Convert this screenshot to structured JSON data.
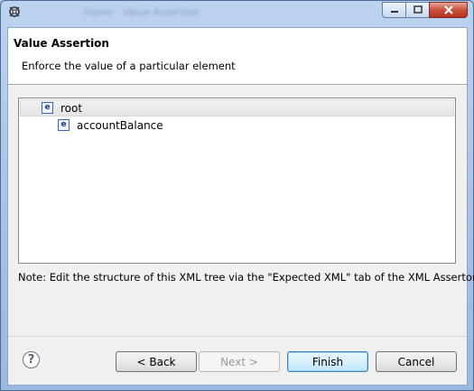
{
  "window": {
    "title": "Home · Value Assertion",
    "caption_buttons": [
      "minimize-icon",
      "maximize-icon",
      "close-icon"
    ]
  },
  "header": {
    "title": "Value Assertion",
    "description": "Enforce the value of a particular element"
  },
  "tree": {
    "items": [
      {
        "icon": "element-icon",
        "icon_glyph": "e",
        "label": "root",
        "level": 0,
        "selected": true
      },
      {
        "icon": "element-icon",
        "icon_glyph": "e",
        "label": "accountBalance",
        "level": 1,
        "selected": false
      }
    ]
  },
  "note": "Note: Edit the structure of this XML tree via the \"Expected XML\" tab of the XML Assertor.",
  "buttons": {
    "back": "< Back",
    "next": "Next >",
    "finish": "Finish",
    "cancel": "Cancel",
    "help_glyph": "?"
  }
}
